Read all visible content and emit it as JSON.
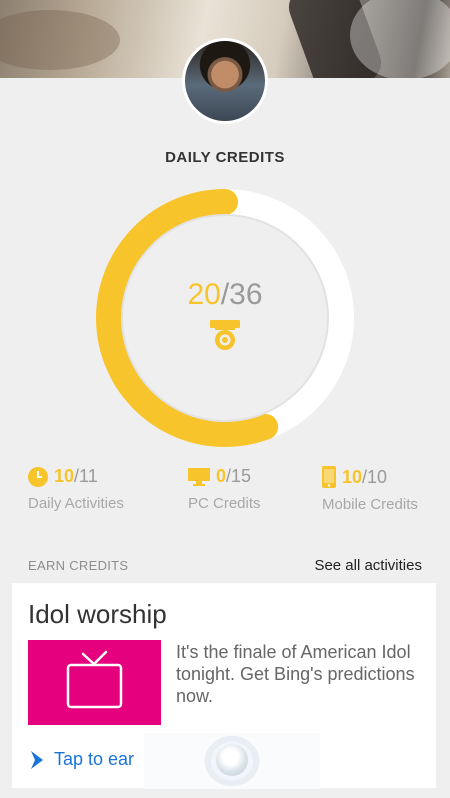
{
  "header": {
    "title": "DAILY CREDITS"
  },
  "progress": {
    "current": "20",
    "total": "/36",
    "fraction": 0.556
  },
  "stats": [
    {
      "current": "10",
      "total": "/11",
      "label": "Daily Activities",
      "icon": "clock-icon"
    },
    {
      "current": "0",
      "total": "/15",
      "label": "PC Credits",
      "icon": "monitor-icon"
    },
    {
      "current": "10",
      "total": "/10",
      "label": "Mobile Credits",
      "icon": "phone-icon"
    }
  ],
  "earn": {
    "label": "EARN CREDITS",
    "see_all": "See all activities"
  },
  "card": {
    "title": "Idol worship",
    "description": "It's the finale of American Idol tonight. Get Bing's predictions now.",
    "tap_label": "Tap to ear",
    "image_icon": "tv-icon"
  },
  "colors": {
    "accent": "#f7c42b",
    "link": "#1a73d9",
    "thumb": "#e5007d"
  }
}
